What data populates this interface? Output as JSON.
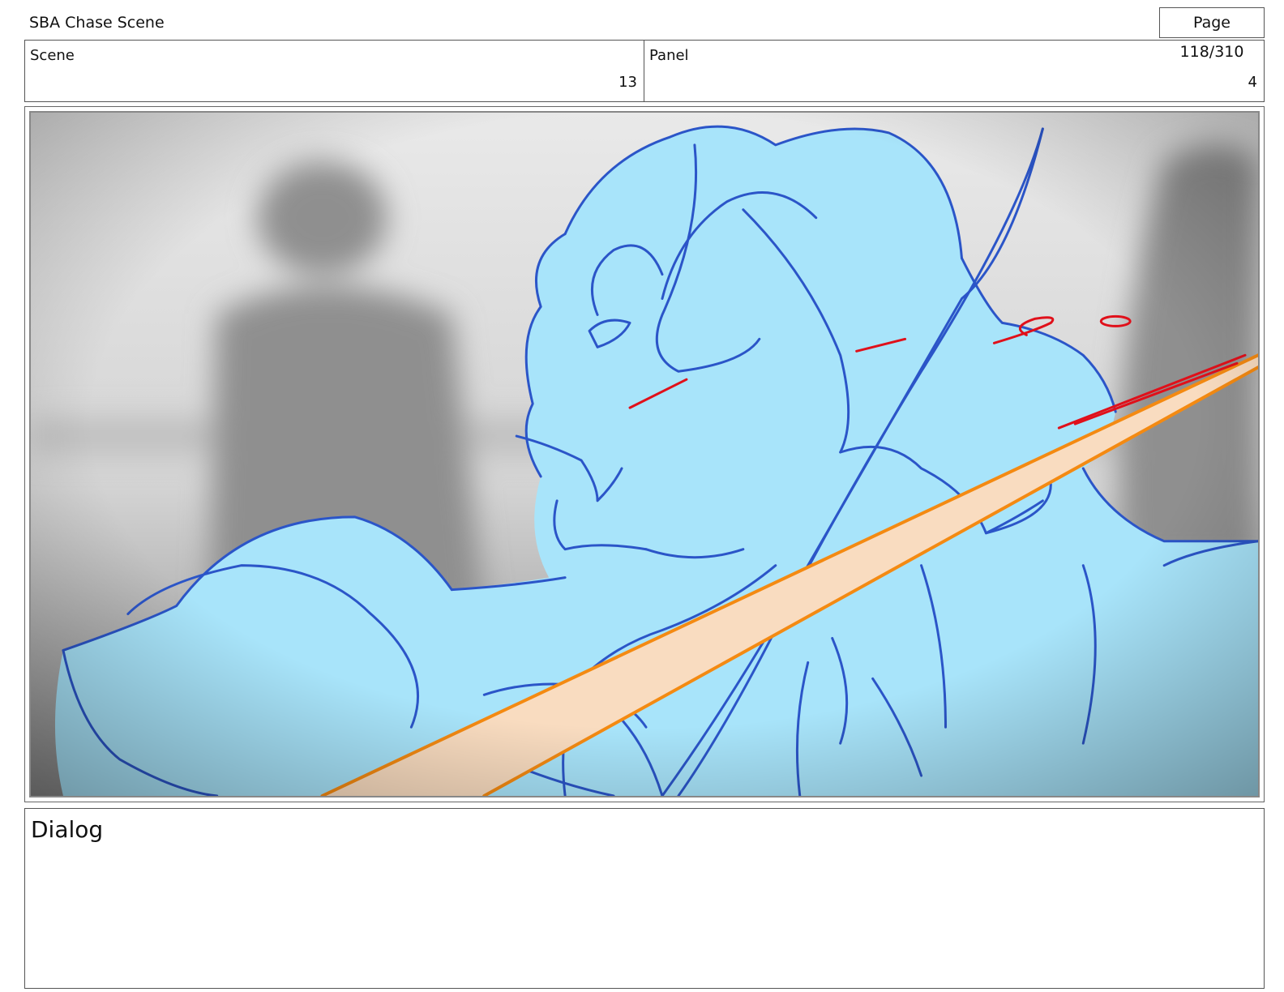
{
  "header": {
    "title": "SBA Chase Scene",
    "page": "Page 118/310"
  },
  "scene": {
    "label": "Scene",
    "value": "13"
  },
  "panel": {
    "label": "Panel",
    "value": "4"
  },
  "frame": {
    "icons": [
      "storyboard-sketch-image"
    ],
    "colors": {
      "character_fill": "#a8e4fa",
      "sketch_line": "#2b55c8",
      "beam": "#f48a12",
      "beam_fill": "#f9dcc0",
      "accent": "#e0101a"
    }
  },
  "dialog": {
    "label": "Dialog"
  }
}
